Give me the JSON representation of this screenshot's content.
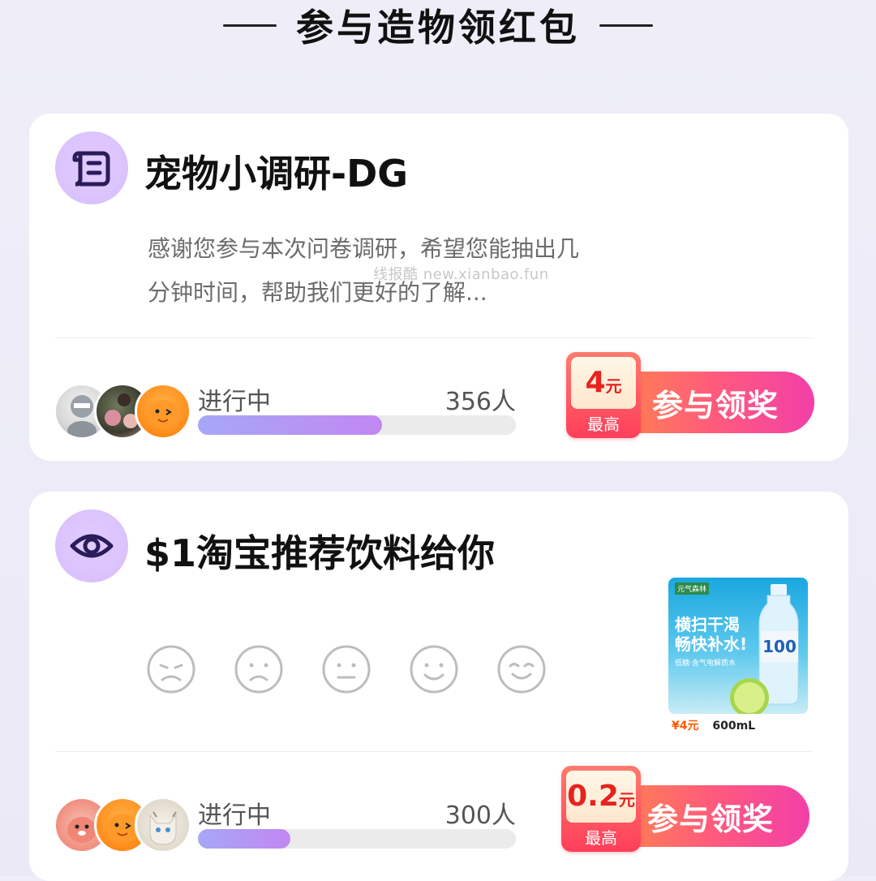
{
  "header": {
    "title": "参与造物领红包"
  },
  "cards": [
    {
      "title": "宠物小调研-DG",
      "icon": "scroll-icon",
      "description": "感谢您参与本次问卷调研，希望您能抽出几分钟时间，帮助我们更好的了解...",
      "watermark": "线报酷 new.xianbao.fun",
      "status": "进行中",
      "participants": "356人",
      "progress_fraction": 0.58,
      "reward": {
        "amount": "4",
        "unit": "元",
        "label": "最高",
        "button": "参与领奖"
      }
    },
    {
      "title": "$1淘宝推荐饮料给你",
      "icon": "eye-icon",
      "rating_faces": [
        "very-sad-face-icon",
        "sad-face-icon",
        "neutral-face-icon",
        "smile-face-icon",
        "happy-face-icon"
      ],
      "product": {
        "brand": "元气森林",
        "slogan_line1": "横扫干渴",
        "slogan_line2": "畅快补水!",
        "sub": "低糖·含气电解质水",
        "price": "¥4元",
        "volume": "600mL"
      },
      "status": "进行中",
      "participants": "300人",
      "progress_fraction": 0.29,
      "reward": {
        "amount": "0.2",
        "unit": "元",
        "label": "最高",
        "button": "参与领奖"
      }
    }
  ],
  "colors": {
    "accent_purple": "#c287f2",
    "button_gradient_start": "#ff8a46",
    "button_gradient_end": "#f23fa8",
    "badge_red": "#e6231f"
  }
}
